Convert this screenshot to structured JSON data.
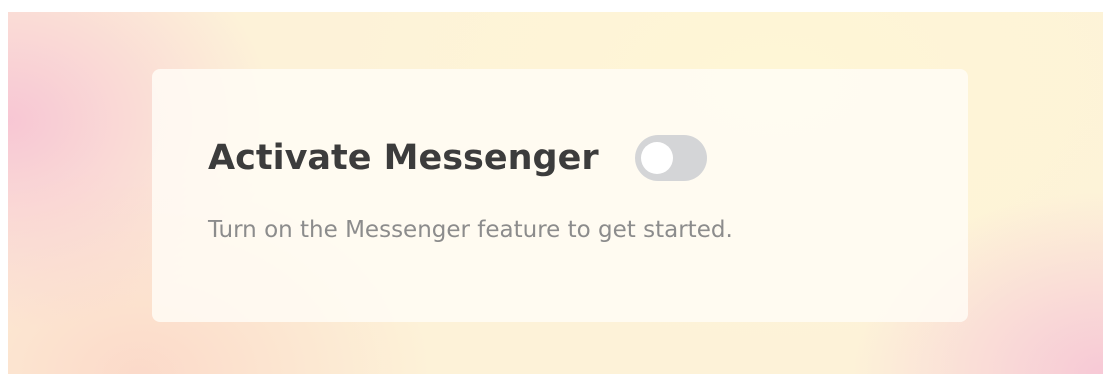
{
  "messenger_card": {
    "title": "Activate Messenger",
    "toggle": {
      "state": "off",
      "track_color": "#d4d5d7",
      "knob_color": "#ffffff"
    },
    "description": "Turn on the Messenger feature to get started."
  },
  "colors": {
    "title_text": "#3c3c3c",
    "description_text": "#8c8c8c",
    "card_background": "#fffcf6",
    "background_pink": "#f7c4d4",
    "background_cream": "#fef6d6"
  }
}
